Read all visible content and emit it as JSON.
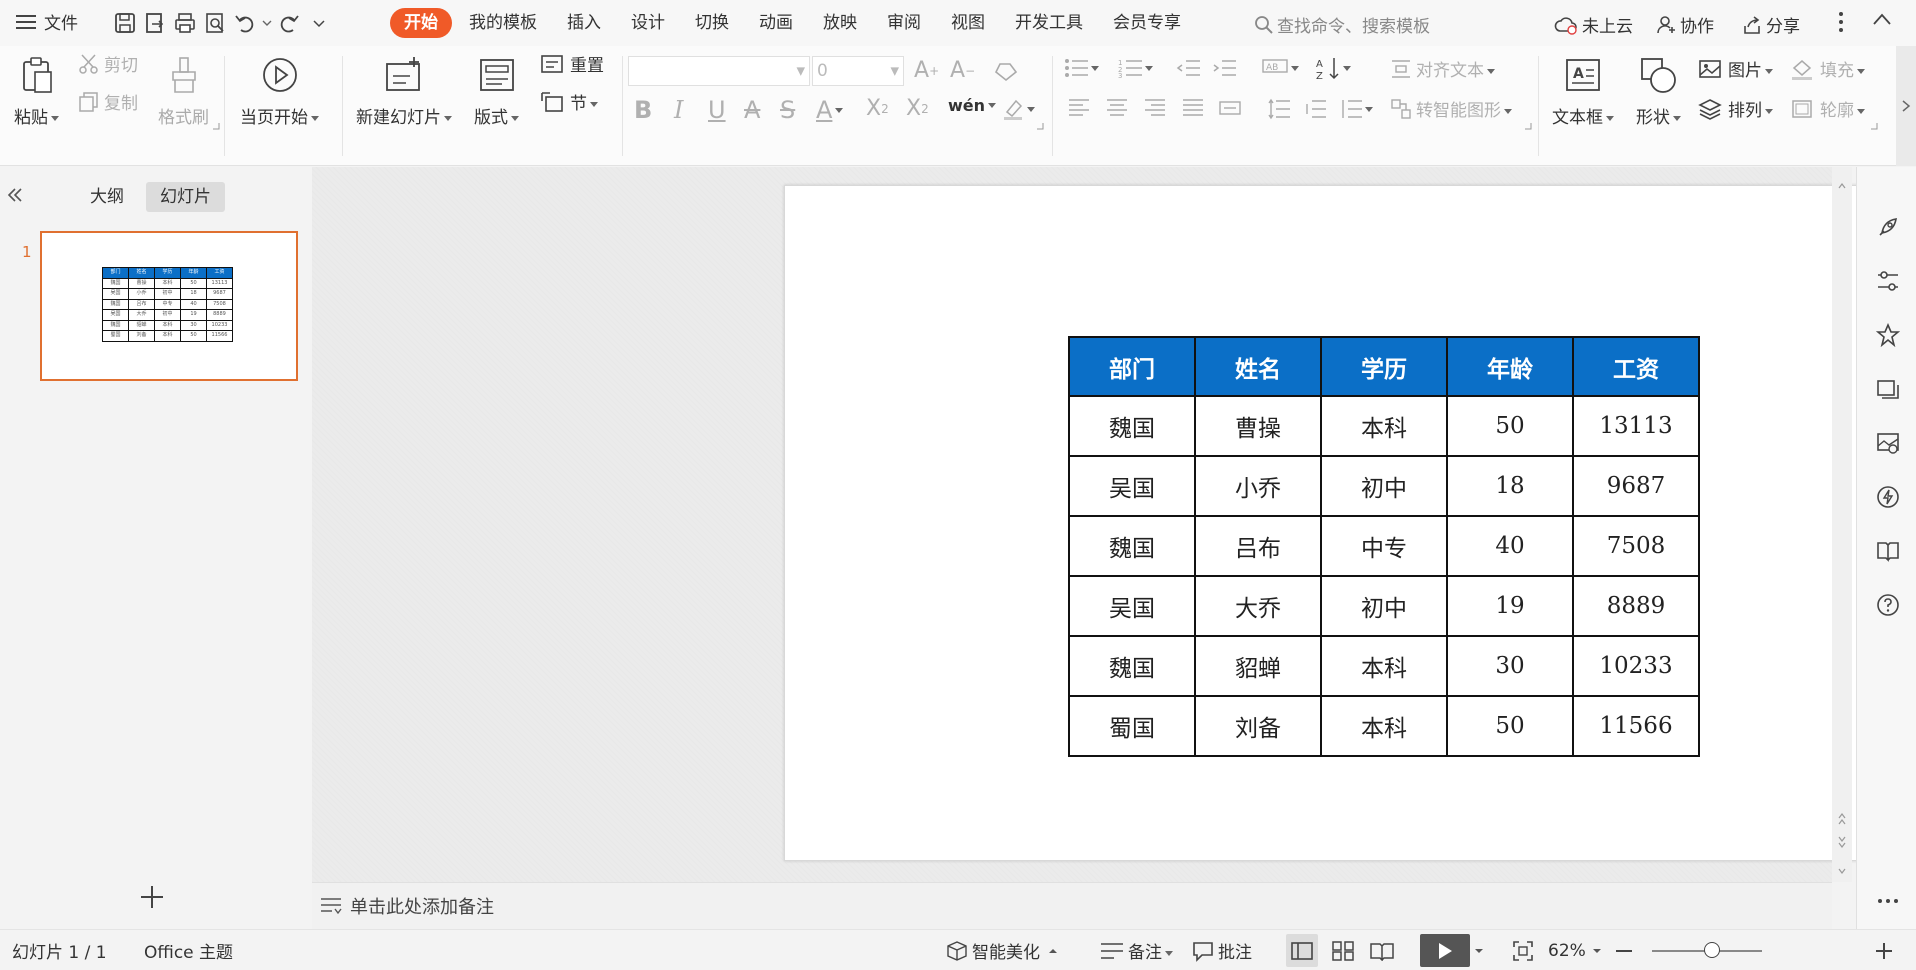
{
  "menubar": {
    "file_label": "文件",
    "tabs": [
      "开始",
      "我的模板",
      "插入",
      "设计",
      "切换",
      "动画",
      "放映",
      "审阅",
      "视图",
      "开发工具",
      "会员专享"
    ],
    "search_placeholder": "查找命令、搜索模板",
    "cloud_label": "未上云",
    "collab_label": "协作",
    "share_label": "分享"
  },
  "ribbon": {
    "paste": "粘贴",
    "cut": "剪切",
    "copy": "复制",
    "format_painter": "格式刷",
    "play_current": "当页开始",
    "new_slide": "新建幻灯片",
    "layout": "版式",
    "reset": "重置",
    "section": "节",
    "font_size_value": "0",
    "align_text": "对齐文本",
    "smartart": "转智能图形",
    "textbox": "文本框",
    "shape": "形状",
    "picture": "图片",
    "arrange": "排列",
    "fill": "填充",
    "outline": "轮廓"
  },
  "leftpanel": {
    "outline_tab": "大纲",
    "slides_tab": "幻灯片",
    "slide_number": "1"
  },
  "table": {
    "headers": [
      "部门",
      "姓名",
      "学历",
      "年龄",
      "工资"
    ],
    "rows": [
      [
        "魏国",
        "曹操",
        "本科",
        "50",
        "13113"
      ],
      [
        "吴国",
        "小乔",
        "初中",
        "18",
        "9687"
      ],
      [
        "魏国",
        "吕布",
        "中专",
        "40",
        "7508"
      ],
      [
        "吴国",
        "大乔",
        "初中",
        "19",
        "8889"
      ],
      [
        "魏国",
        "貂蝉",
        "本科",
        "30",
        "10233"
      ],
      [
        "蜀国",
        "刘备",
        "本科",
        "50",
        "11566"
      ]
    ]
  },
  "notes": {
    "placeholder": "单击此处添加备注"
  },
  "status": {
    "slide_count": "幻灯片 1 / 1",
    "theme": "Office 主题",
    "beautify": "智能美化",
    "notes": "备注",
    "comments": "批注",
    "zoom": "62%"
  },
  "colors": {
    "accent": "#f05a28",
    "table_header": "#0b6fc7",
    "thumb_border": "#e07030"
  }
}
